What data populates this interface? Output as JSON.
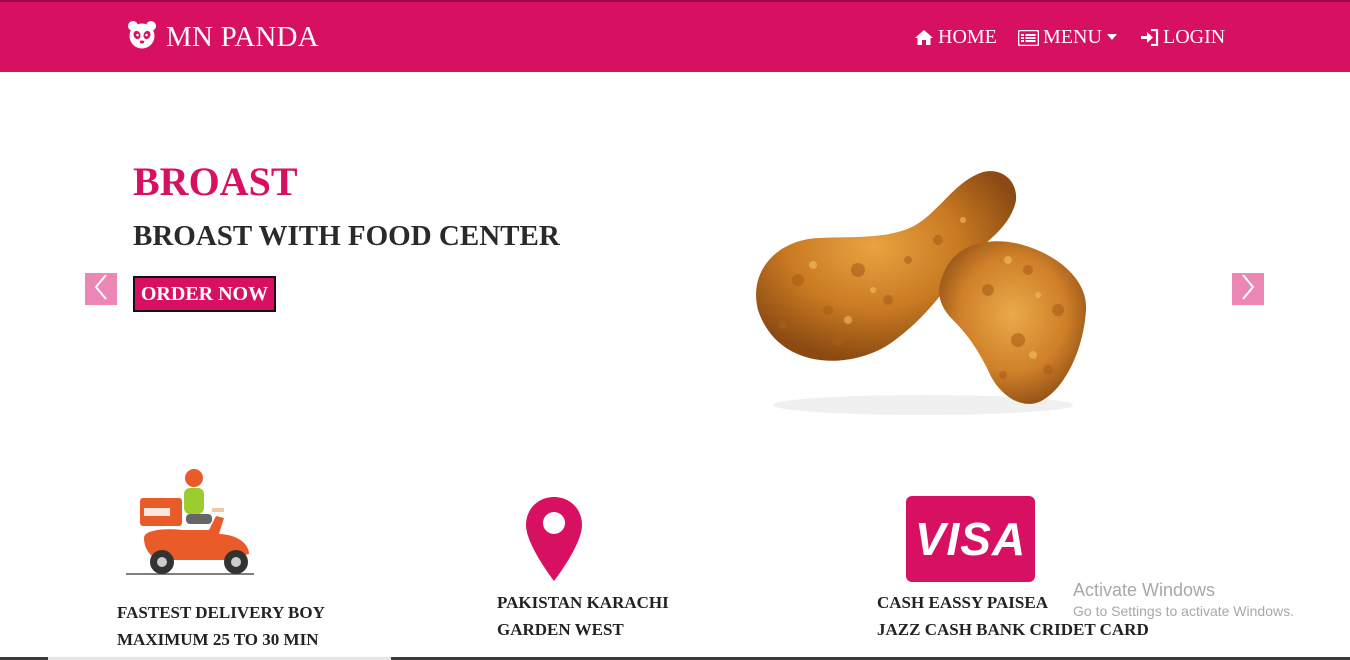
{
  "brand": {
    "name": "MN PANDA",
    "icon": "panda-icon"
  },
  "nav": {
    "home": {
      "label": "HOME",
      "icon": "home-icon"
    },
    "menu": {
      "label": "MENU",
      "icon": "list-icon"
    },
    "login": {
      "label": "LOGIN",
      "icon": "sign-in-icon"
    }
  },
  "hero": {
    "title": "BROAST",
    "subtitle": "BROAST WITH FOOD CENTER",
    "button": "ORDER NOW",
    "image": "fried-chicken-drumsticks"
  },
  "features": [
    {
      "icon": "delivery-scooter-icon",
      "line1": "FASTEST DELIVERY BOY",
      "line2": "MAXIMUM 25 TO 30 MIN"
    },
    {
      "icon": "location-pin-icon",
      "line1": "PAKISTAN KARACHI",
      "line2": "GARDEN WEST"
    },
    {
      "icon": "visa-card-icon",
      "line1": "CASH EASSY PAISEA",
      "line2": "JAZZ CASH BANK CRIDET CARD",
      "badge": "VISA"
    }
  ],
  "watermark": {
    "line1": "Activate Windows",
    "line2": "Go to Settings to activate Windows."
  },
  "colors": {
    "brand": "#d81062",
    "arrow": "#ec87b5",
    "text_dark": "#2a2a2a"
  }
}
